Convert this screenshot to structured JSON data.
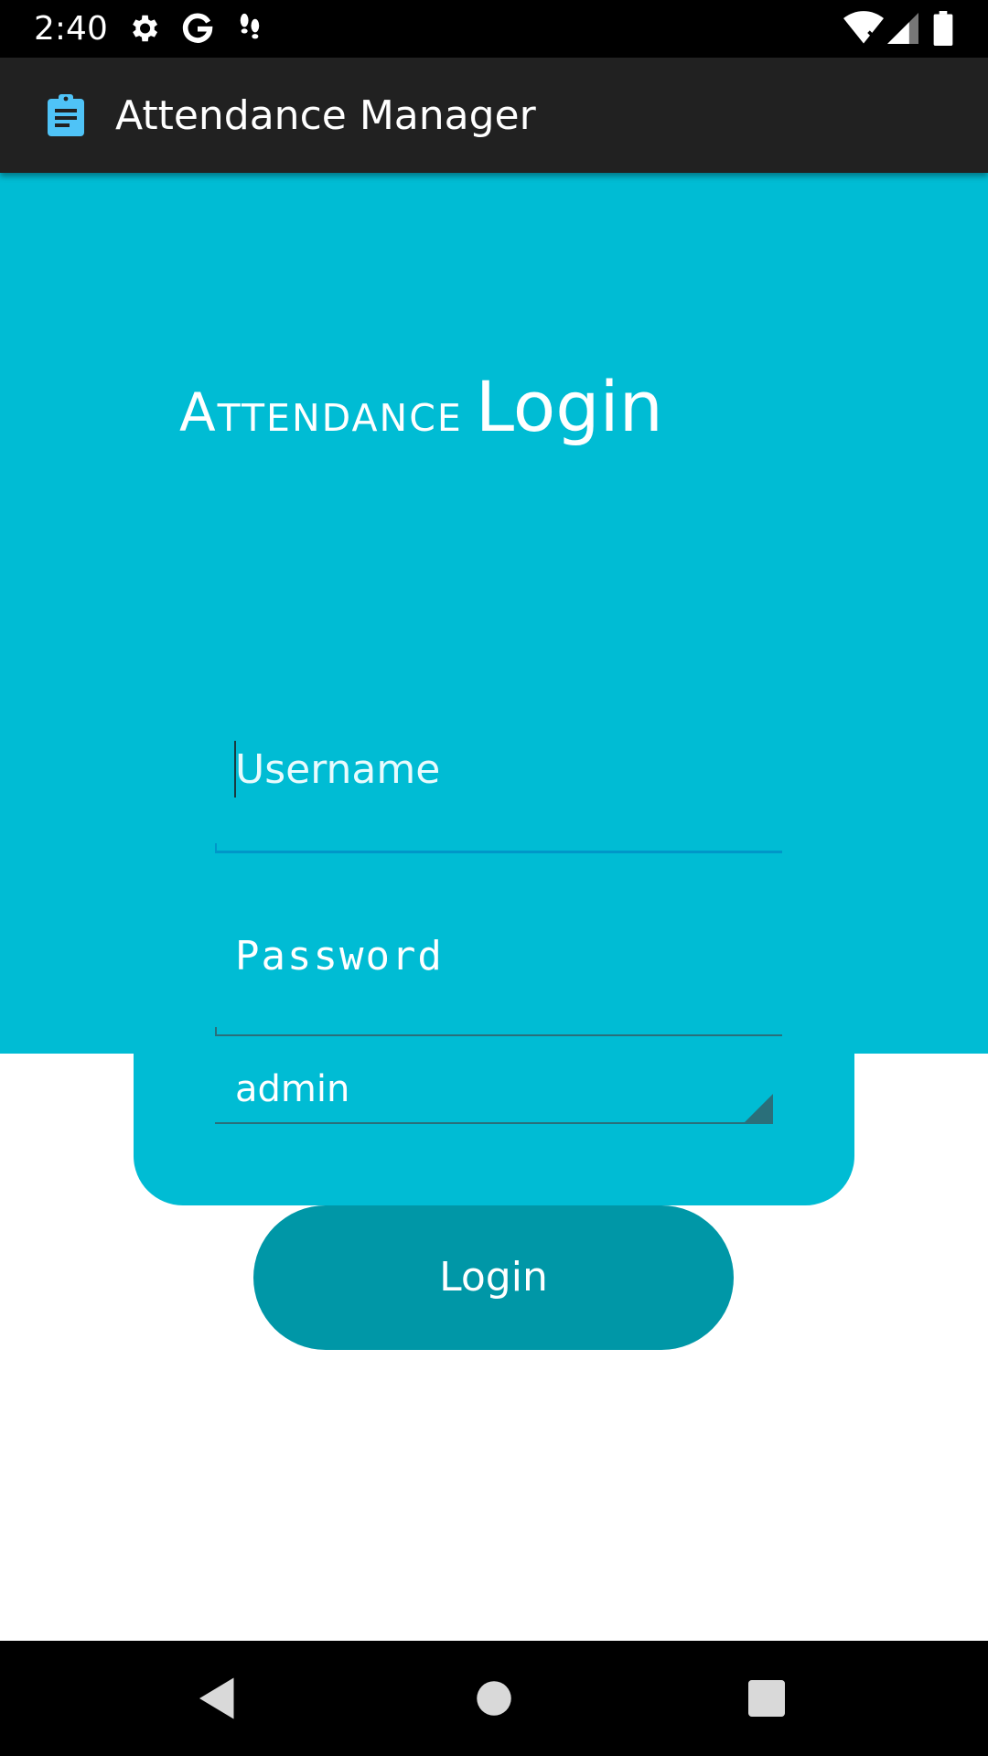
{
  "status_bar": {
    "time": "2:40",
    "icons": [
      "settings-gear-icon",
      "google-g-icon",
      "footsteps-icon",
      "wifi-no-internet-icon",
      "cell-signal-icon",
      "battery-icon"
    ]
  },
  "app_bar": {
    "title": "Attendance Manager",
    "icon": "clipboard-icon"
  },
  "header": {
    "headline_prefix": "Attendance",
    "headline_main": "Login"
  },
  "form": {
    "username_placeholder": "Username",
    "password_placeholder": "Password",
    "role_selected": "admin"
  },
  "actions": {
    "login_label": "Login"
  },
  "nav_bar": {
    "buttons": [
      "back-icon",
      "home-icon",
      "recents-icon"
    ]
  },
  "colors": {
    "primary": "#00bcd4",
    "button": "#0097a7",
    "app_bar": "#212121",
    "app_icon": "#4fc3f7"
  }
}
